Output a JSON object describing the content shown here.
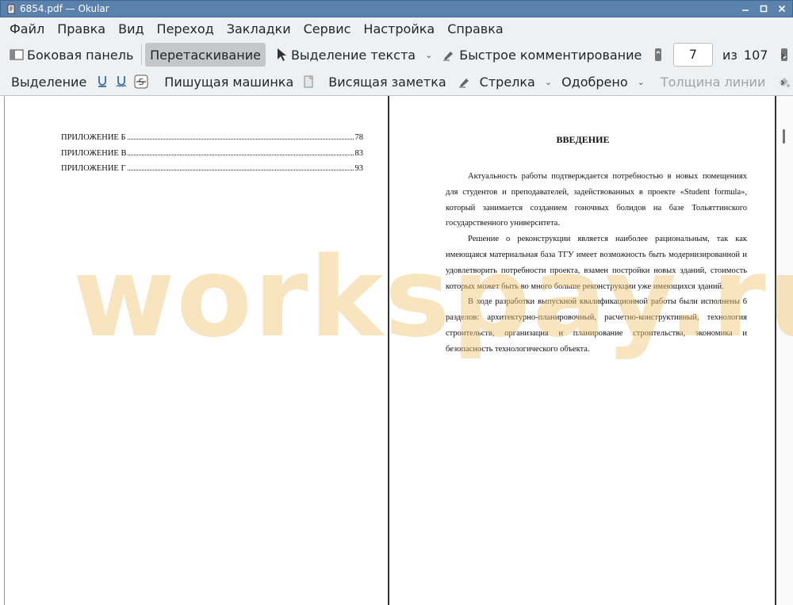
{
  "window": {
    "title": "6854.pdf  — Okular"
  },
  "menu": [
    "Файл",
    "Правка",
    "Вид",
    "Переход",
    "Закладки",
    "Сервис",
    "Настройка",
    "Справка"
  ],
  "toolbar1": {
    "sidebar": "Боковая панель",
    "drag": "Перетаскивание",
    "text_select": "Выделение текста",
    "quick_comment": "Быстрое комментирование",
    "page_current": "7",
    "page_of": "из",
    "page_total": "107"
  },
  "toolbar2": {
    "highlight": "Выделение",
    "typewriter": "Пишущая машинка",
    "note": "Висящая заметка",
    "arrow": "Стрелка",
    "stamp": "Одобрено",
    "line_width": "Толщина линии"
  },
  "left_page": {
    "toc": [
      {
        "label": "ПРИЛОЖЕНИЕ Б",
        "page": "78"
      },
      {
        "label": "ПРИЛОЖЕНИЕ В ",
        "page": "83"
      },
      {
        "label": "ПРИЛОЖЕНИЕ Г",
        "page": "93"
      }
    ]
  },
  "right_page": {
    "heading": "ВВЕДЕНИЕ",
    "paragraphs": [
      "Актуальность работы подтверждается потребностью в новых помещениях для студентов и преподавателей, задействованных в проекте «Student formula», который занимается созданием гоночных болидов на базе Тольяттинского государственного университета.",
      "Решение о реконструкции является наиболее рациональным, так как имеющаяся материальная база ТГУ имеет возможность быть модернизированной и удовлетворить потребности проекта, взамен постройки новых зданий, стоимость которых может быть во много больше реконструкции уже имеющихся зданий.",
      "В ходе разработки выпускной квалификационной работы были исполнены 6 разделов: архитектурно-планировочный, расчетно-конструктивный, технология строительств, организация и планирование строительства, экономика и безопасность технологического объекта."
    ]
  },
  "watermark": "workspay.ru",
  "colors": {
    "titlebar": "#5b82ad",
    "toolbar_bg": "#eff0f1",
    "watermark": "#f0c46e"
  }
}
